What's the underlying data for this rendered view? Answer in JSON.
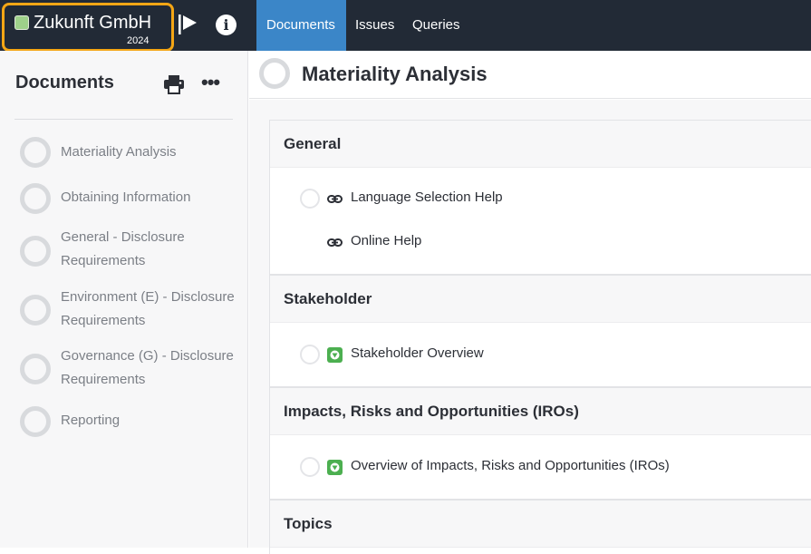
{
  "topbar": {
    "org_name": "Zukunft GmbH",
    "org_year": "2024",
    "org_status_color": "#9ed08a",
    "highlight_color": "#f5a615",
    "flag_icon": "flag-icon",
    "info_icon": "info-icon",
    "info_glyph": "i",
    "tabs": [
      {
        "label": "Documents",
        "active": true
      },
      {
        "label": "Issues",
        "active": false
      },
      {
        "label": "Queries",
        "active": false
      }
    ],
    "accent_color": "#3b86c8"
  },
  "sidebar": {
    "title": "Documents",
    "print_icon": "printer-icon",
    "more_icon": "more-icon",
    "more_glyph": "•••",
    "items": [
      {
        "label": "Materiality Analysis"
      },
      {
        "label": "Obtaining Information"
      },
      {
        "label": "General - Disclosure Requirements"
      },
      {
        "label": "Environment (E) - Disclosure Requirements"
      },
      {
        "label": "Governance (G) - Disclosure Requirements"
      },
      {
        "label": "Reporting"
      }
    ]
  },
  "main": {
    "title": "Materiality Analysis",
    "sections": [
      {
        "title": "General",
        "rows": [
          {
            "label": "Language Selection Help",
            "icon": "link-icon",
            "has_status": true
          },
          {
            "label": "Online Help",
            "icon": "link-icon",
            "has_status": false
          }
        ]
      },
      {
        "title": "Stakeholder",
        "rows": [
          {
            "label": "Stakeholder Overview",
            "icon": "module-icon",
            "has_status": true
          }
        ]
      },
      {
        "title": "Impacts, Risks and Opportunities (IROs)",
        "rows": [
          {
            "label": "Overview of Impacts, Risks and Opportunities (IROs)",
            "icon": "module-icon",
            "has_status": true
          }
        ]
      },
      {
        "title": "Topics",
        "rows": []
      }
    ],
    "module_icon_color": "#4caf50"
  }
}
